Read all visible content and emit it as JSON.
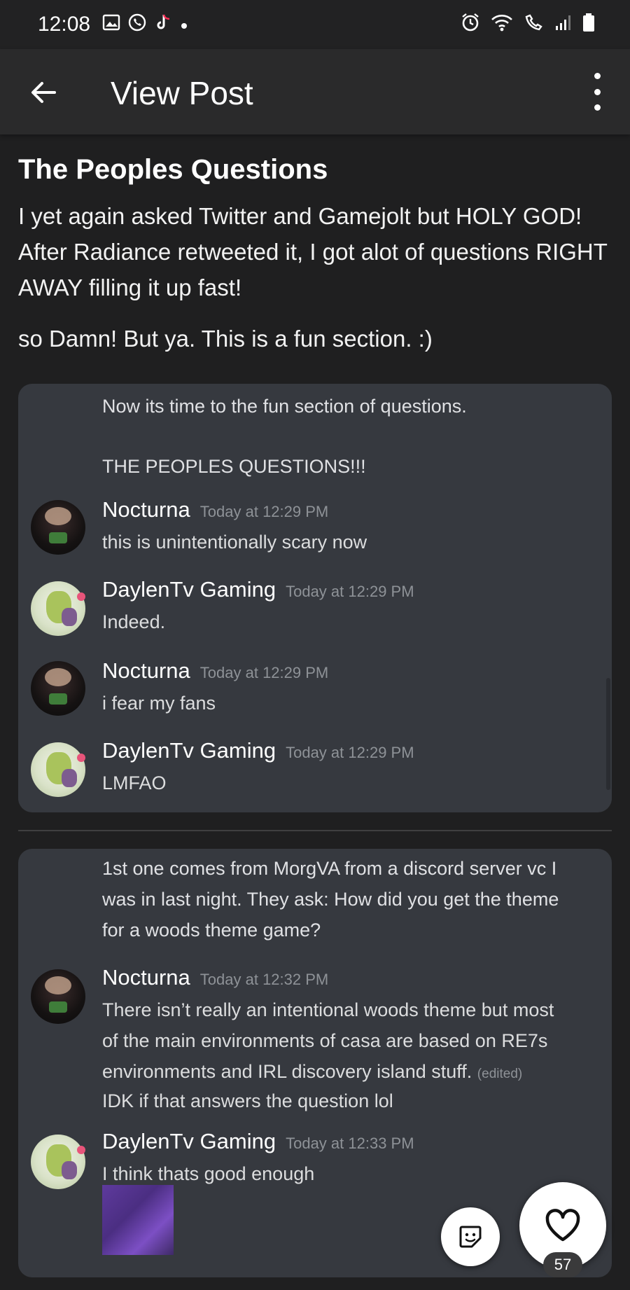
{
  "status_bar": {
    "time": "12:08",
    "left_icons": [
      "gallery-icon",
      "whatsapp-icon",
      "tiktok-icon",
      "dot-icon"
    ],
    "right_icons": [
      "alarm-icon",
      "wifi-icon",
      "wifi-calling-icon",
      "signal-icon",
      "battery-icon"
    ]
  },
  "header": {
    "title": "View Post"
  },
  "post": {
    "title": "The Peoples Questions",
    "paragraphs": [
      "I yet again asked Twitter and Gamejolt but HOLY GOD! After Radiance retweeted it, I got alot of questions RIGHT AWAY filling it up fast!",
      "so Damn! But ya. This is a fun section. :)"
    ]
  },
  "screenshot1": {
    "intro_line1": "Now its time to the fun section of questions.",
    "intro_line2": "THE PEOPLES QUESTIONS!!!",
    "messages": [
      {
        "author": "Nocturna",
        "time": "Today at 12:29 PM",
        "text": "this is unintentionally scary now"
      },
      {
        "author": "DaylenTv Gaming",
        "time": "Today at 12:29 PM",
        "text": "Indeed."
      },
      {
        "author": "Nocturna",
        "time": "Today at 12:29 PM",
        "text": "i fear my fans"
      },
      {
        "author": "DaylenTv Gaming",
        "time": "Today at 12:29 PM",
        "text": "LMFAO"
      }
    ]
  },
  "screenshot2": {
    "intro_lines": [
      "1st one comes from MorgVA from a discord server vc I",
      "was in last night. They ask: How did you get the theme",
      "for a woods theme game?"
    ],
    "msg1": {
      "author": "Nocturna",
      "time": "Today at 12:32 PM",
      "lines": [
        "There isn’t really an intentional woods theme but most",
        "of the main environments of casa are based on RE7s",
        "environments and IRL discovery island stuff."
      ],
      "edited": "(edited)",
      "last_line": "IDK if that answers the question lol"
    },
    "msg2": {
      "author": "DaylenTv Gaming",
      "time": "Today at 12:33 PM",
      "text": "I think thats good enough"
    }
  },
  "actions": {
    "like_count": "57"
  }
}
